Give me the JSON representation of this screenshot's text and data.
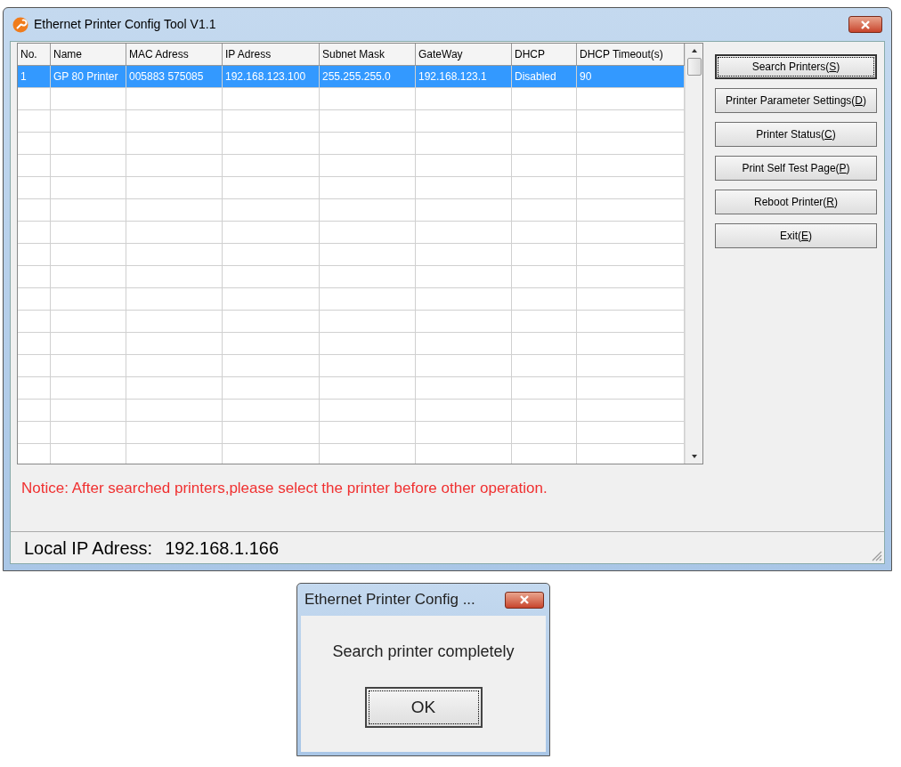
{
  "window": {
    "title": "Ethernet Printer Config Tool V1.1"
  },
  "table": {
    "columns": [
      "No.",
      "Name",
      "MAC Adress",
      "IP Adress",
      "Subnet Mask",
      "GateWay",
      "DHCP",
      "DHCP Timeout(s)"
    ],
    "rows": [
      {
        "selected": true,
        "cells": [
          "1",
          "GP 80 Printer",
          "005883 575085",
          "192.168.123.100",
          "255.255.255.0",
          "192.168.123.1",
          "Disabled",
          "90"
        ]
      }
    ]
  },
  "buttons": [
    {
      "before": "Search Printers(",
      "mnemonic": "S",
      "after": ")",
      "focused": true
    },
    {
      "before": "Printer Parameter Settings(",
      "mnemonic": "D",
      "after": ")",
      "focused": false
    },
    {
      "before": "Printer Status(",
      "mnemonic": "C",
      "after": ")",
      "focused": false
    },
    {
      "before": "Print Self Test Page(",
      "mnemonic": "P",
      "after": ")",
      "focused": false
    },
    {
      "before": "Reboot Printer(",
      "mnemonic": "R",
      "after": ")",
      "focused": false
    },
    {
      "before": "Exit(",
      "mnemonic": "E",
      "after": ")",
      "focused": false
    }
  ],
  "notice": "Notice: After searched printers,please select the printer before other operation.",
  "status_bar": {
    "label": "Local IP Adress:",
    "value": "192.168.1.166"
  },
  "dialog": {
    "title": "Ethernet Printer Config ...",
    "message": "Search printer completely",
    "button": {
      "label": "OK",
      "focused": true
    }
  }
}
